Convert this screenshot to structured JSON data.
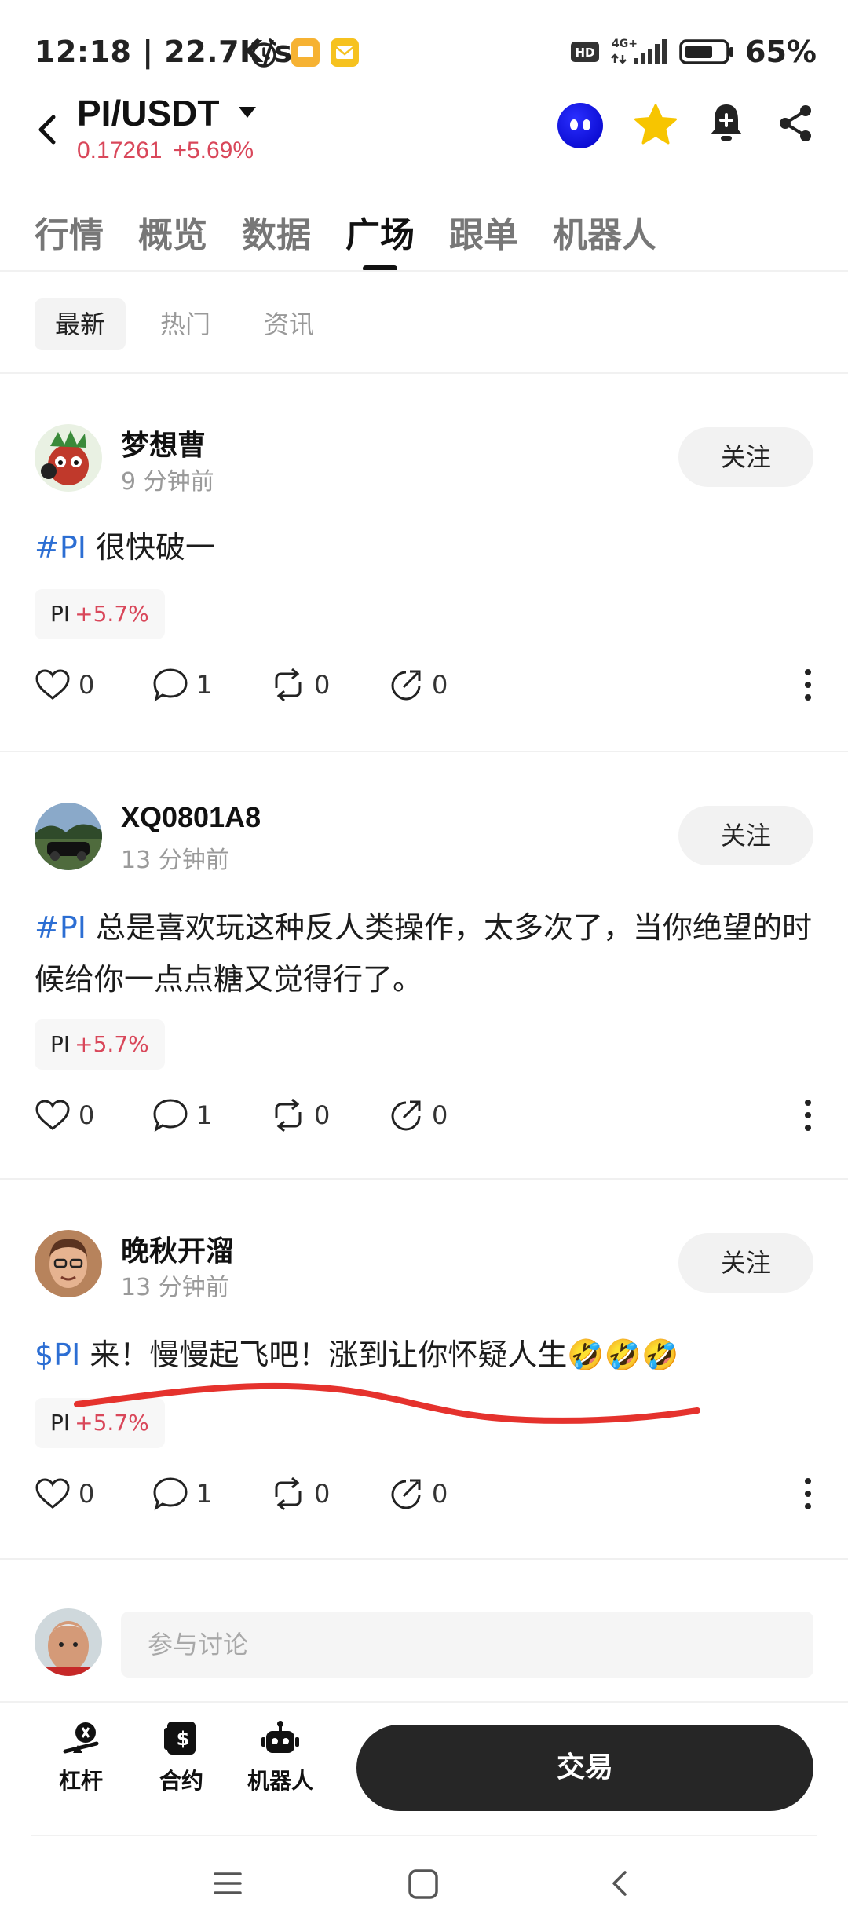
{
  "status_bar": {
    "time": "12:18 | 22.7K/s",
    "network": "4G+",
    "hd": "HD",
    "battery": "65%"
  },
  "header": {
    "pair": "PI/USDT",
    "price": "0.17261",
    "change": "+5.69%"
  },
  "tabs": [
    "行情",
    "概览",
    "数据",
    "广场",
    "跟单",
    "机器人"
  ],
  "active_tab": "广场",
  "filters": [
    "最新",
    "热门",
    "资讯"
  ],
  "posts": [
    {
      "user": "梦想曹",
      "time": "9 分钟前",
      "follow": "关注",
      "tag": "#PI",
      "text": " 很快破一",
      "ticker": "PI",
      "ticker_change": "+5.7%",
      "likes": "0",
      "comments": "1",
      "reposts": "0",
      "shares": "0"
    },
    {
      "user": "XQ0801A8",
      "time": "13 分钟前",
      "follow": "关注",
      "tag": "#PI",
      "text": " 总是喜欢玩这种反人类操作，太多次了，当你绝望的时候给你一点点糖又觉得行了。",
      "ticker": "PI",
      "ticker_change": "+5.7%",
      "likes": "0",
      "comments": "1",
      "reposts": "0",
      "shares": "0"
    },
    {
      "user": "晚秋开溜",
      "time": "13 分钟前",
      "follow": "关注",
      "tag": "$PI",
      "text": " 来！慢慢起飞吧！涨到让你怀疑人生🤣🤣🤣",
      "ticker": "PI",
      "ticker_change": "+5.7%",
      "likes": "0",
      "comments": "1",
      "reposts": "0",
      "shares": "0"
    }
  ],
  "comment_box": {
    "placeholder": "参与讨论"
  },
  "toolbar": {
    "leverage": "杠杆",
    "contract": "合约",
    "robot": "机器人",
    "trade": "交易"
  },
  "colors": {
    "up": "#d9475a",
    "tag": "#2c6ed3",
    "trade_button": "#262626",
    "annotation_stroke": "#e5322d"
  },
  "icons": [
    "alarm-icon",
    "message-icon",
    "mail-icon",
    "signal-icon",
    "battery-icon",
    "back-icon",
    "mascot-icon",
    "star-icon",
    "bell-icon",
    "share-icon",
    "heart-icon",
    "comment-icon",
    "repost-icon",
    "share-post-icon",
    "more-icon",
    "leverage-icon",
    "contract-icon",
    "robot-icon",
    "menu-icon",
    "home-icon",
    "nav-back-icon"
  ]
}
